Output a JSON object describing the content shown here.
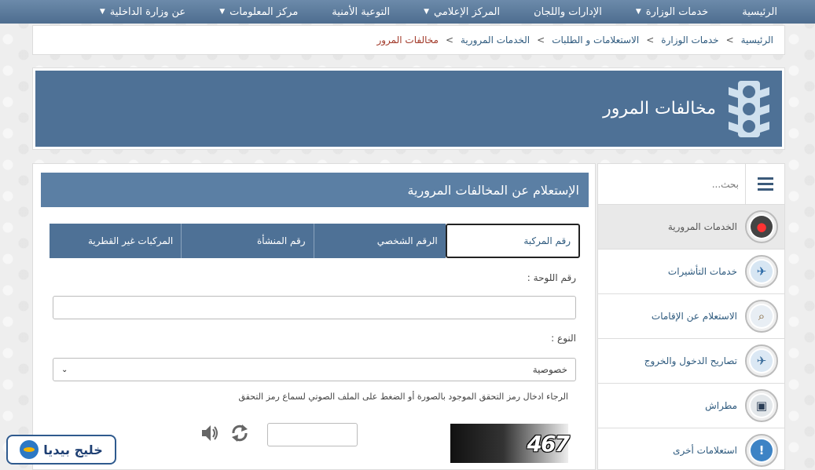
{
  "topnav": {
    "items": [
      {
        "label": "الرئيسية",
        "dropdown": false
      },
      {
        "label": "خدمات الوزارة",
        "dropdown": true
      },
      {
        "label": "الإدارات واللجان",
        "dropdown": false
      },
      {
        "label": "المركز الإعلامي",
        "dropdown": true
      },
      {
        "label": "التوعية الأمنية",
        "dropdown": false
      },
      {
        "label": "مركز المعلومات",
        "dropdown": true
      },
      {
        "label": "عن وزارة الداخلية",
        "dropdown": true
      }
    ]
  },
  "breadcrumb": {
    "items": [
      "الرئيسية",
      "خدمات الوزارة",
      "الاستعلامات و الطلبات",
      "الخدمات المرورية",
      "مخالفات المرور"
    ],
    "separator": ">"
  },
  "banner": {
    "title": "مخالفات المرور",
    "icon": "traffic-light-icon"
  },
  "sidebar": {
    "search_placeholder": "بحث...",
    "items": [
      {
        "label": "الخدمات المرورية",
        "icon": "traffic-light-icon",
        "active": true
      },
      {
        "label": "خدمات التأشيرات",
        "icon": "visa-icon",
        "active": false
      },
      {
        "label": "الاستعلام عن الإقامات",
        "icon": "magnifier-icon",
        "active": false
      },
      {
        "label": "تصاريح الدخول والخروج",
        "icon": "airplane-icon",
        "active": false
      },
      {
        "label": "مطراش",
        "icon": "computer-icon",
        "active": false
      },
      {
        "label": "استعلامات أخرى",
        "icon": "info-icon",
        "active": false
      }
    ]
  },
  "main": {
    "title": "الإستعلام عن المخالفات المرورية",
    "tabs": [
      {
        "label": "رقم المركبة",
        "active": true
      },
      {
        "label": "الرقم الشخصي",
        "active": false
      },
      {
        "label": "رقم المنشأة",
        "active": false
      },
      {
        "label": "المركبات غير القطرية",
        "active": false
      }
    ],
    "plate_label": "رقم اللوحة :",
    "plate_value": "",
    "type_label": "النوع :",
    "type_selected": "خصوصية",
    "captcha_hint": "الرجاء ادخال رمز التحقق الموجود بالصورة أو الضغط على الملف الصوتي لسماع رمز التحقق",
    "captcha_text": "467",
    "captcha_value": ""
  },
  "brand": {
    "text": "خليج بيديا"
  },
  "colors": {
    "nav": "#5a7a9c",
    "banner": "#4e7196",
    "tab": "#4e7196",
    "panel_head": "#5b7fa4"
  }
}
